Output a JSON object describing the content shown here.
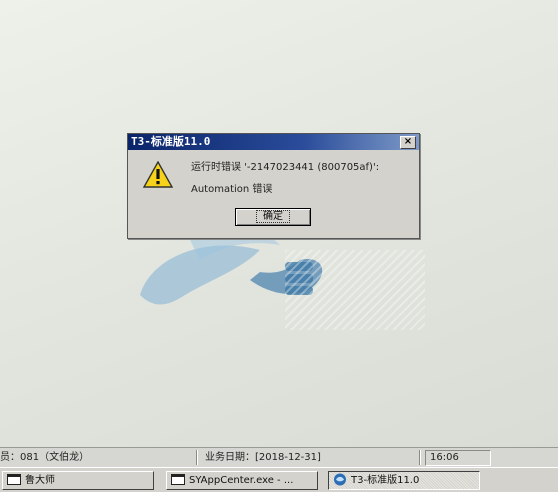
{
  "dialog": {
    "title": "T3-标准版11.0",
    "close_label": "×",
    "message_line1": "运行时错误 '-2147023441 (800705af)':",
    "message_line2": "Automation 错误",
    "ok_label": "确定"
  },
  "statusbar": {
    "operator": "员：081（文伯龙）",
    "business_date": "业务日期：[2018-12-31]",
    "time": "16:06"
  },
  "taskbar": {
    "items": [
      {
        "label": "鲁大师",
        "icon": "window-icon"
      },
      {
        "label": "SYAppCenter.exe - ...",
        "icon": "window-icon"
      },
      {
        "label": "T3-标准版11.0",
        "icon": "t3-app-icon",
        "active": true
      }
    ]
  },
  "colors": {
    "titlebar": "#0a246a",
    "dialog_bg": "#d4d2cc",
    "warning": "#f6d21a",
    "desktop_logo": "#5a8db5"
  }
}
